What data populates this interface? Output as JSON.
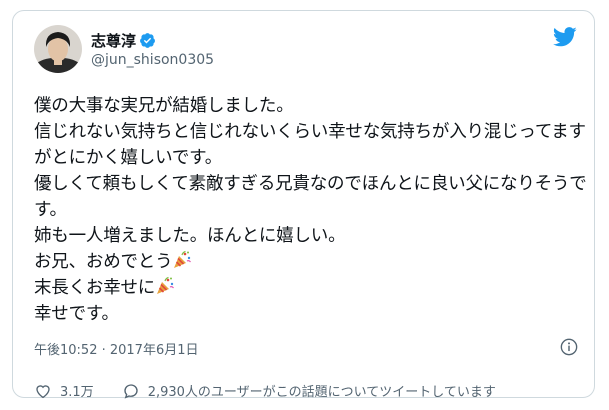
{
  "user": {
    "display_name": "志尊淳",
    "handle": "@jun_shison0305"
  },
  "tweet": {
    "lines": [
      "僕の大事な実兄が結婚しました。",
      "信じれない気持ちと信じれないくらい幸せな気持ちが入り混じってます",
      "がとにかく嬉しいです。",
      "優しくて頼もしくて素敵すぎる兄貴なのでほんとに良い父になりそうで",
      "す。",
      "姉も一人増えました。ほんとに嬉しい。",
      "お兄、おめでとう",
      "末長くお幸せに",
      "幸せです。"
    ],
    "emoji": [
      "party-popper",
      "party-popper"
    ]
  },
  "meta": {
    "timestamp": "午後10:52 · 2017年6月1日"
  },
  "actions": {
    "like_count": "3.1万",
    "reply_text": "2,930人のユーザーがこの話題についてツイートしています"
  },
  "colors": {
    "twitter_blue": "#1d9bf0",
    "text_primary": "#0f1419",
    "text_secondary": "#536471",
    "border": "#cfd9de"
  }
}
